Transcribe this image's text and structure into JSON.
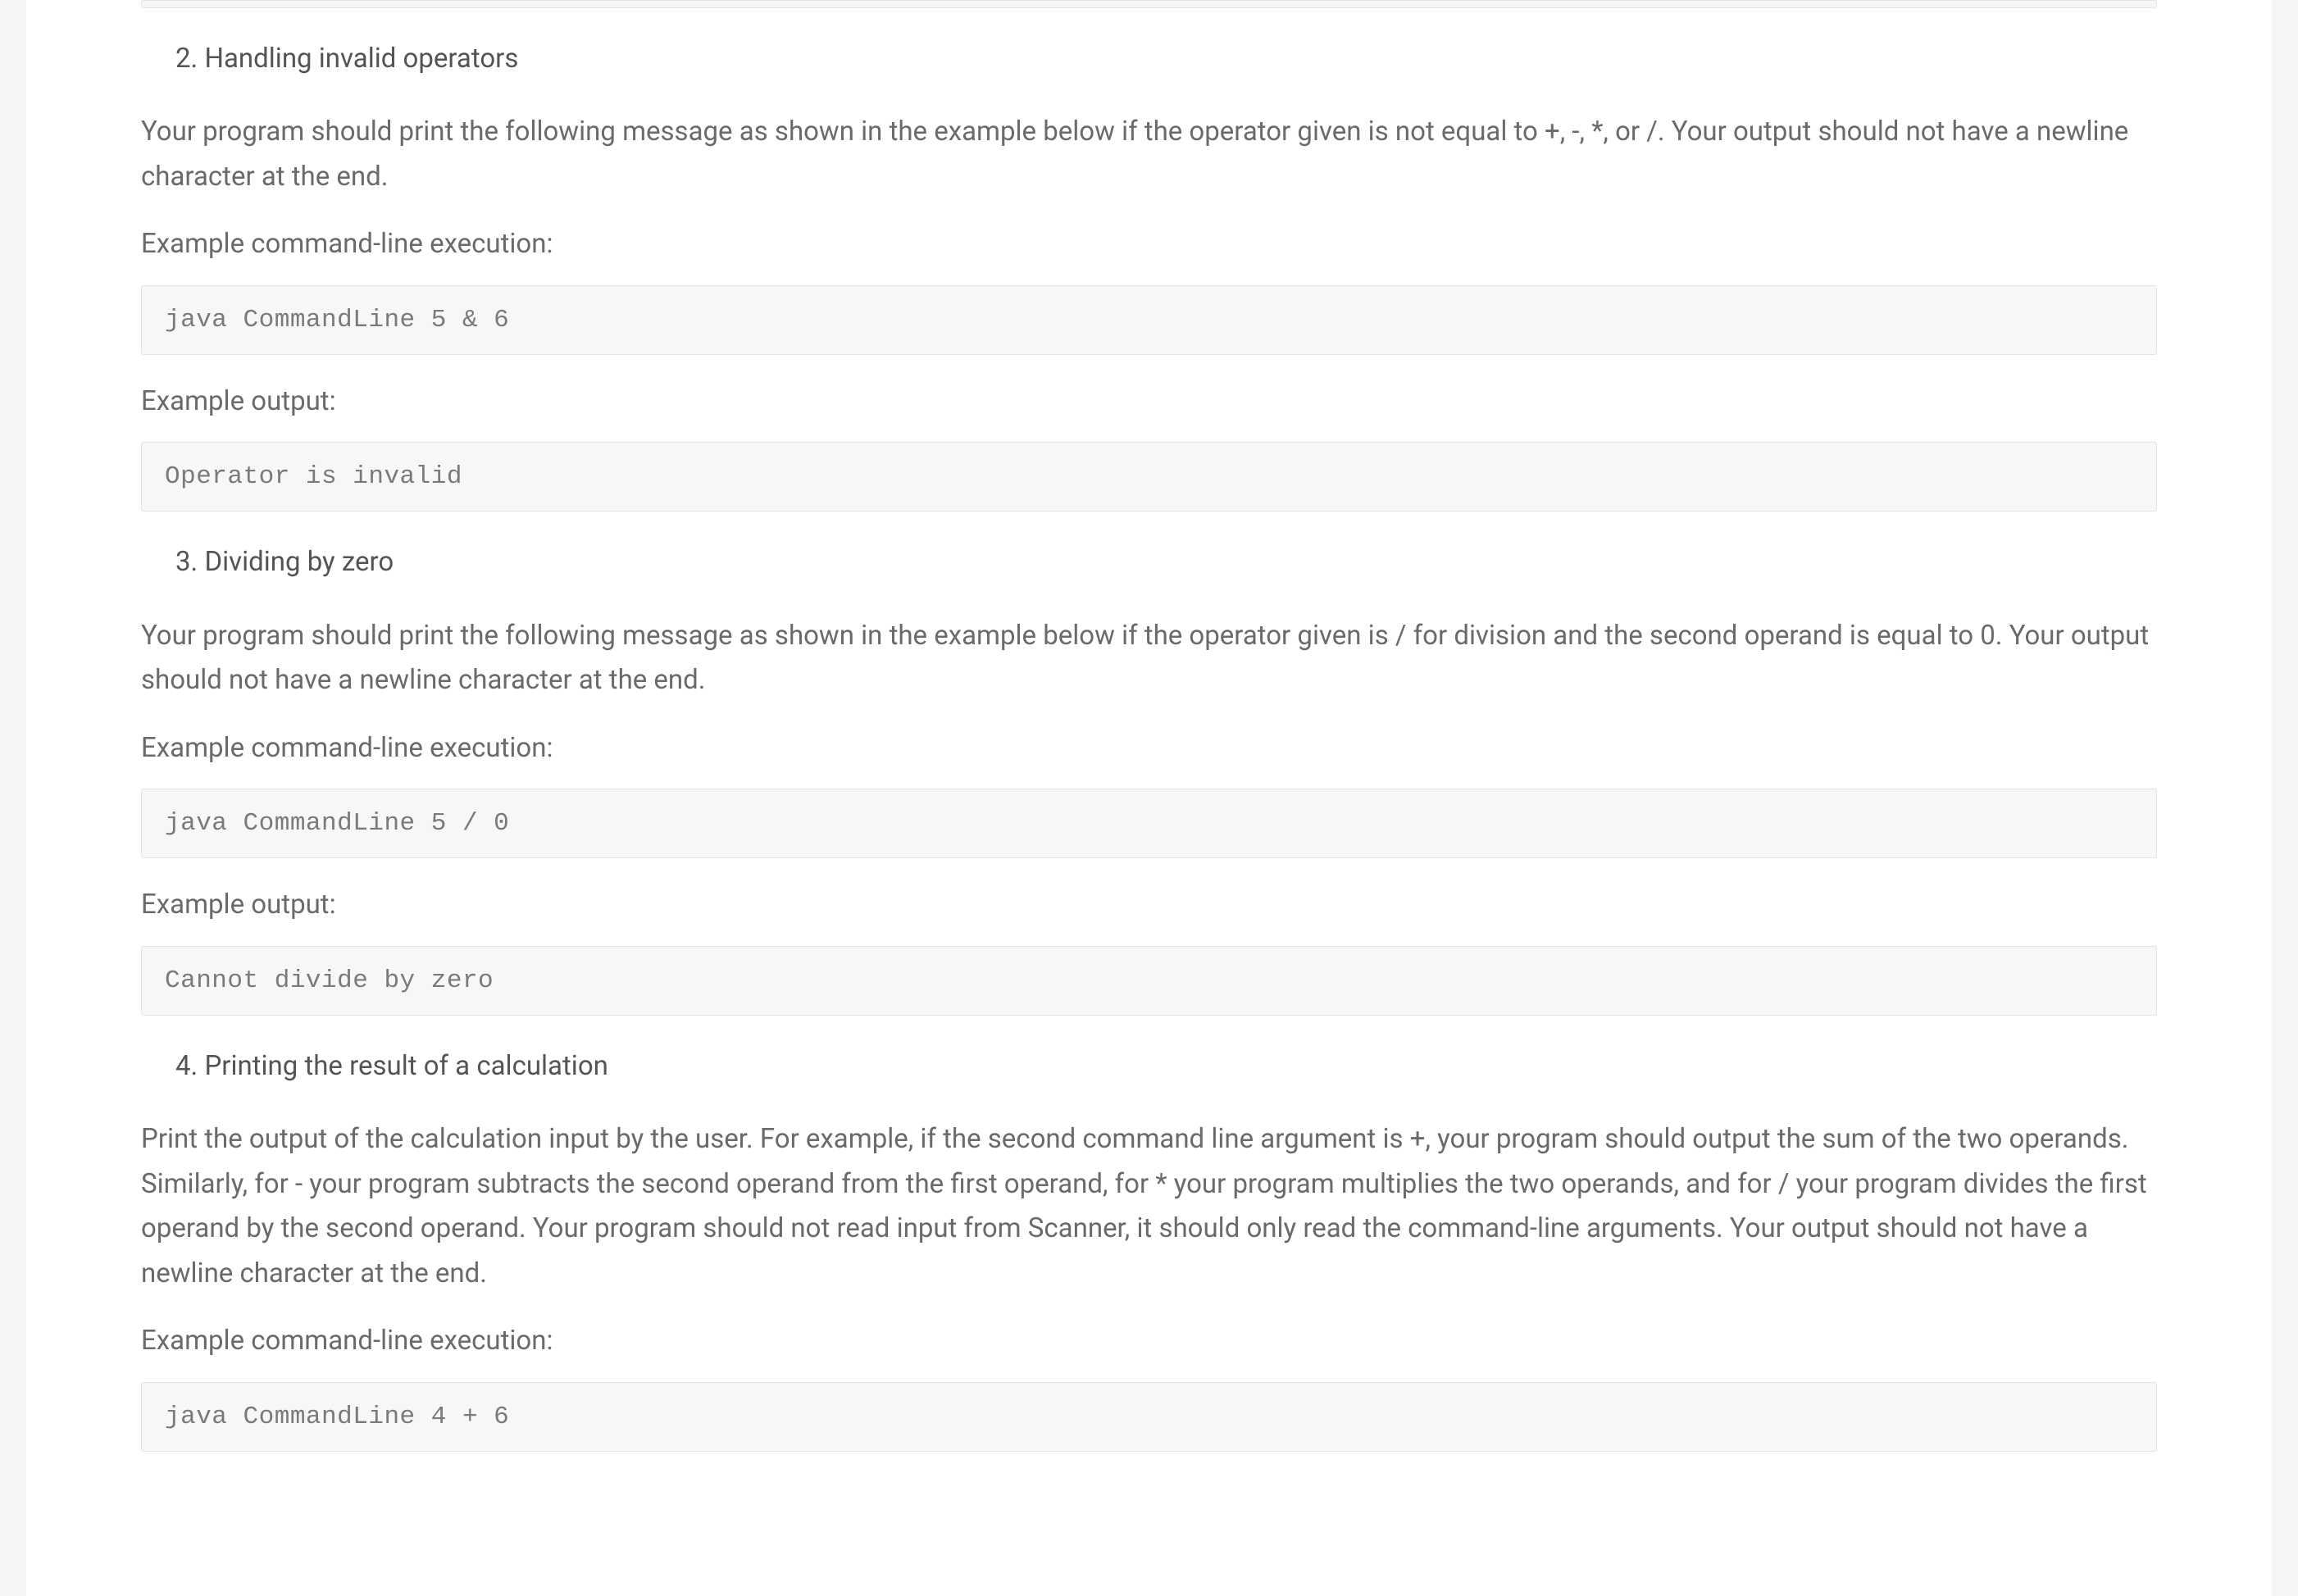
{
  "sections": {
    "item2": {
      "number": "2.",
      "title": "Handling invalid operators",
      "description": "Your program should print the following message as shown in the example below if the operator given is not equal to +, -, *, or /. Your output should not have a newline character at the end.",
      "exec_label": "Example command-line execution:",
      "exec_code": "java CommandLine 5 & 6",
      "output_label": "Example output:",
      "output_code": "Operator is invalid"
    },
    "item3": {
      "number": "3.",
      "title": "Dividing by zero",
      "description": "Your program should print the following message as shown in the example below if the operator given is / for division and the second operand is equal to 0. Your output should not have a newline character at the end.",
      "exec_label": "Example command-line execution:",
      "exec_code": "java CommandLine 5 / 0",
      "output_label": "Example output:",
      "output_code": "Cannot divide by zero"
    },
    "item4": {
      "number": "4.",
      "title": "Printing the result of a calculation",
      "description": "Print the output of the calculation input by the user. For example, if the second command line argument is +, your program should output the sum of the two operands. Similarly, for - your program subtracts the second operand from the first operand, for * your program multiplies the two operands, and for / your program divides the first operand by the second operand. Your program should not read input from Scanner, it should only read the command-line arguments. Your output should not have a newline character at the end.",
      "exec_label": "Example command-line execution:",
      "exec_code": "java CommandLine 4 + 6"
    }
  }
}
